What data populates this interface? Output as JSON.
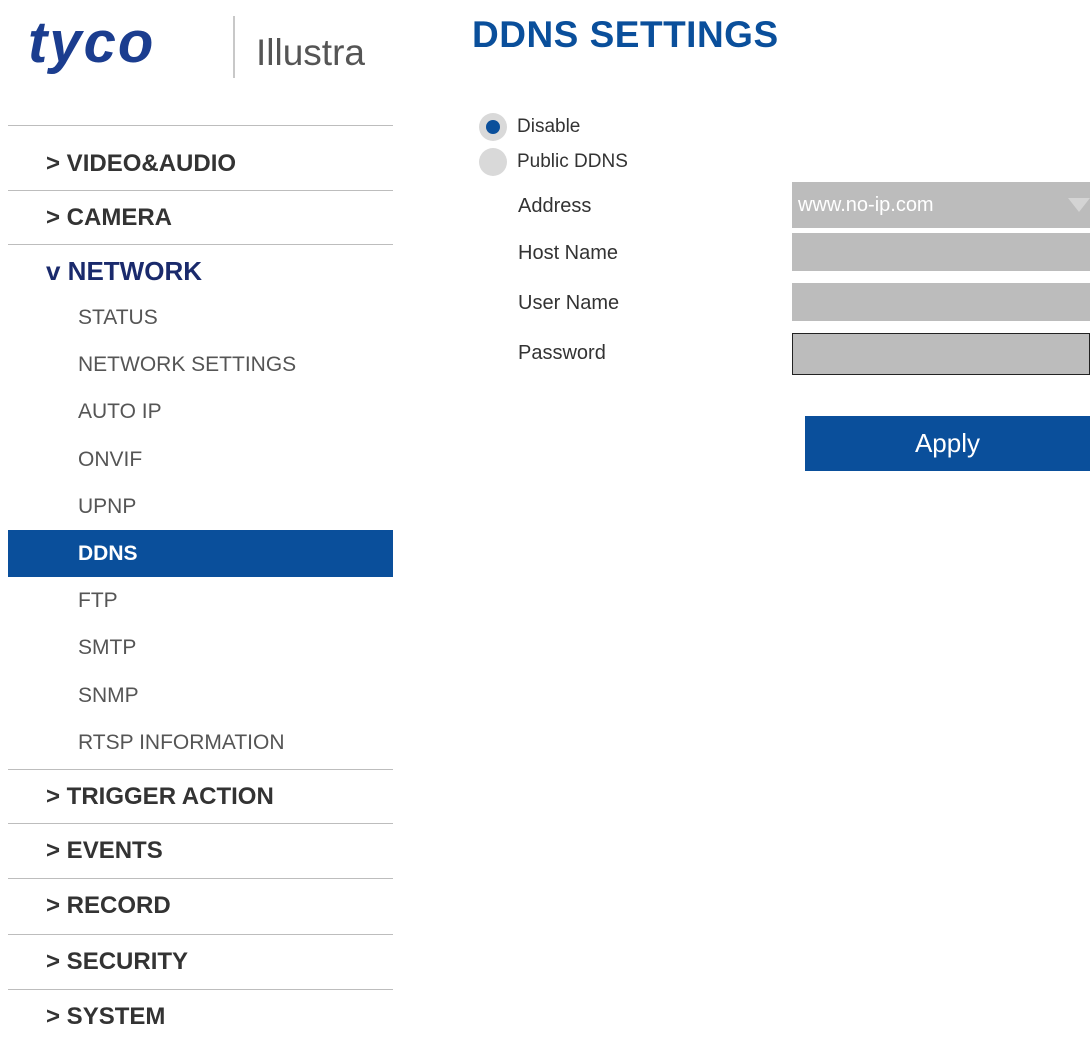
{
  "logo": {
    "brand": "tyco",
    "product": "Illustra"
  },
  "page_title": "DDNS SETTINGS",
  "sidebar": {
    "sections_before": [
      {
        "label": "> VIDEO&AUDIO"
      },
      {
        "label": "> CAMERA"
      }
    ],
    "open_section": {
      "label": "v NETWORK",
      "items": [
        {
          "label": "STATUS"
        },
        {
          "label": "NETWORK SETTINGS"
        },
        {
          "label": "AUTO IP"
        },
        {
          "label": "ONVIF"
        },
        {
          "label": "UPNP"
        },
        {
          "label": "DDNS",
          "active": true
        },
        {
          "label": "FTP"
        },
        {
          "label": "SMTP"
        },
        {
          "label": "SNMP"
        },
        {
          "label": "RTSP INFORMATION"
        }
      ]
    },
    "sections_after": [
      {
        "label": "> TRIGGER ACTION"
      },
      {
        "label": "> EVENTS"
      },
      {
        "label": "> RECORD"
      },
      {
        "label": "> SECURITY"
      },
      {
        "label": "> SYSTEM"
      }
    ]
  },
  "ddns": {
    "mode_options": [
      {
        "label": "Disable",
        "checked": true
      },
      {
        "label": "Public DDNS",
        "checked": false
      }
    ],
    "address": {
      "label": "Address",
      "value": "www.no-ip.com"
    },
    "host_name": {
      "label": "Host Name",
      "value": ""
    },
    "user_name": {
      "label": "User Name",
      "value": ""
    },
    "password": {
      "label": "Password",
      "value": ""
    },
    "apply_label": "Apply"
  },
  "colors": {
    "brand_blue": "#0a4f9b",
    "logo_blue": "#1b3d8f",
    "disabled_gray": "#bcbcbc"
  }
}
